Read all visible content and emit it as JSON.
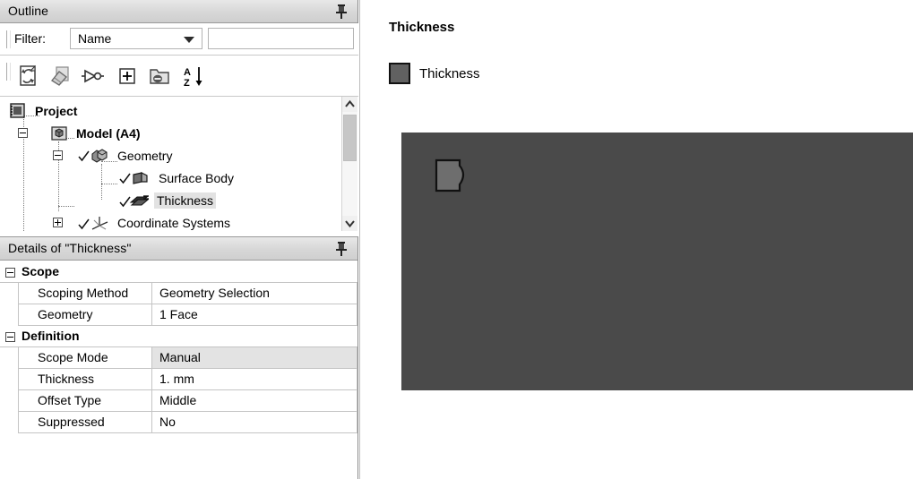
{
  "outline_panel": {
    "title": "Outline",
    "pin_icon": "pin-icon",
    "filter": {
      "label": "Filter:",
      "combo_value": "Name",
      "combo_arrow_icon": "chevron-down-icon",
      "text_value": "",
      "text_placeholder": ""
    },
    "toolbar": [
      {
        "name": "refresh-document-icon",
        "title": "Update Geometry"
      },
      {
        "name": "eraser-icon",
        "title": "Clear Generated Data"
      },
      {
        "name": "named-selection-icon",
        "title": "Named Selection"
      },
      {
        "name": "expand-all-icon",
        "title": "Expand All"
      },
      {
        "name": "collapse-folder-icon",
        "title": "Collapse Folder"
      },
      {
        "name": "sort-az-icon",
        "title": "Sort Alphabetically"
      }
    ],
    "tree": [
      {
        "label": "Project",
        "icon": "project-icon",
        "level": 0,
        "bold": true,
        "selected": false,
        "expander": "none",
        "check": false
      },
      {
        "label": "Model (A4)",
        "icon": "model-icon",
        "level": 1,
        "bold": true,
        "selected": false,
        "expander": "minus",
        "check": false
      },
      {
        "label": "Geometry",
        "icon": "geometry-icon",
        "level": 2,
        "bold": false,
        "selected": false,
        "expander": "minus",
        "check": true
      },
      {
        "label": "Surface Body",
        "icon": "surface-body-icon",
        "level": 3,
        "bold": false,
        "selected": false,
        "expander": "none",
        "check": true
      },
      {
        "label": "Thickness",
        "icon": "thickness-icon",
        "level": 3,
        "bold": false,
        "selected": true,
        "expander": "none",
        "check": true
      },
      {
        "label": "Coordinate Systems",
        "icon": "coord-sys-icon",
        "level": 2,
        "bold": false,
        "selected": false,
        "expander": "plus",
        "check": true
      }
    ],
    "scrollbar": {
      "up_arrow_icon": "chevron-up-icon",
      "down_arrow_icon": "chevron-down-icon"
    }
  },
  "details_panel": {
    "title": "Details of \"Thickness\"",
    "pin_icon": "pin-icon",
    "sections": [
      {
        "group": "Scope",
        "rows": [
          {
            "label": "Scoping Method",
            "value": "Geometry Selection",
            "highlighted": false
          },
          {
            "label": "Geometry",
            "value": "1 Face",
            "highlighted": false
          }
        ]
      },
      {
        "group": "Definition",
        "rows": [
          {
            "label": "Scope Mode",
            "value": "Manual",
            "highlighted": true
          },
          {
            "label": "Thickness",
            "value": "1. mm",
            "highlighted": false
          },
          {
            "label": "Offset Type",
            "value": "Middle",
            "highlighted": false
          },
          {
            "label": "Suppressed",
            "value": "No",
            "highlighted": false
          }
        ]
      }
    ]
  },
  "graphics": {
    "title": "Thickness",
    "legend": {
      "label": "Thickness",
      "swatch_color": "#616161"
    },
    "viewport": {
      "background_color": "#4a4a4a",
      "shape_fill": "#6e6e6e",
      "shape_outline": "#111111"
    }
  }
}
